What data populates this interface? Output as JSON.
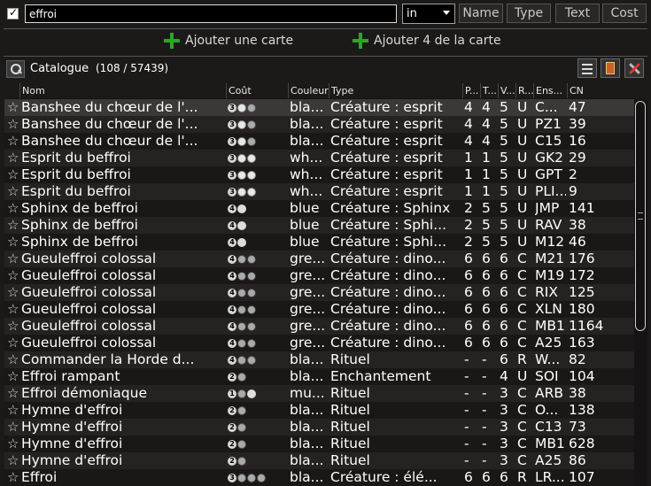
{
  "filter": {
    "checked": true,
    "query": "effroi",
    "mode": "in"
  },
  "sort_buttons": [
    "Name",
    "Type",
    "Text",
    "Cost"
  ],
  "add_buttons": {
    "add_one": "Ajouter une carte",
    "add_four": "Ajouter 4 de la carte"
  },
  "catalogue": {
    "label": "Catalogue",
    "count": "(108 / 57439)"
  },
  "columns": [
    "Nom",
    "Coût",
    "Couleur",
    "Type",
    "P...",
    "T...",
    "V...",
    "R...",
    "Ens...",
    "CN"
  ],
  "rows": [
    {
      "name": "Banshee du chœur de l'...",
      "mana": [
        "3",
        "w",
        "b"
      ],
      "color": "bla...",
      "type": "Créature : esprit",
      "p": "4",
      "t": "4",
      "v": "5",
      "r": "U",
      "set": "C...",
      "cn": "47"
    },
    {
      "name": "Banshee du chœur de l'...",
      "mana": [
        "3",
        "w",
        "b"
      ],
      "color": "bla...",
      "type": "Créature : esprit",
      "p": "4",
      "t": "4",
      "v": "5",
      "r": "U",
      "set": "PZ1",
      "cn": "39"
    },
    {
      "name": "Banshee du chœur de l'...",
      "mana": [
        "3",
        "w",
        "b"
      ],
      "color": "bla...",
      "type": "Créature : esprit",
      "p": "4",
      "t": "4",
      "v": "5",
      "r": "U",
      "set": "C15",
      "cn": "16"
    },
    {
      "name": "Esprit du beffroi",
      "mana": [
        "3",
        "w",
        "w"
      ],
      "color": "wh...",
      "type": "Créature : esprit",
      "p": "1",
      "t": "1",
      "v": "5",
      "r": "U",
      "set": "GK2",
      "cn": "29"
    },
    {
      "name": "Esprit du beffroi",
      "mana": [
        "3",
        "w",
        "w"
      ],
      "color": "wh...",
      "type": "Créature : esprit",
      "p": "1",
      "t": "1",
      "v": "5",
      "r": "U",
      "set": "GPT",
      "cn": "2"
    },
    {
      "name": "Esprit du beffroi",
      "mana": [
        "3",
        "w",
        "w"
      ],
      "color": "wh...",
      "type": "Créature : esprit",
      "p": "1",
      "t": "1",
      "v": "5",
      "r": "U",
      "set": "PLI...",
      "cn": "9"
    },
    {
      "name": "Sphinx de beffroi",
      "mana": [
        "4",
        "u"
      ],
      "color": "blue",
      "type": "Créature : Sphinx",
      "p": "2",
      "t": "5",
      "v": "5",
      "r": "U",
      "set": "JMP",
      "cn": "141"
    },
    {
      "name": "Sphinx de beffroi",
      "mana": [
        "4",
        "u"
      ],
      "color": "blue",
      "type": "Créature : Sphi...",
      "p": "2",
      "t": "5",
      "v": "5",
      "r": "U",
      "set": "RAV",
      "cn": "38"
    },
    {
      "name": "Sphinx de beffroi",
      "mana": [
        "4",
        "u"
      ],
      "color": "blue",
      "type": "Créature : Sphi...",
      "p": "2",
      "t": "5",
      "v": "5",
      "r": "U",
      "set": "M12",
      "cn": "46"
    },
    {
      "name": "Gueuleffroi colossal",
      "mana": [
        "4",
        "g",
        "g"
      ],
      "color": "gre...",
      "type": "Créature : dino...",
      "p": "6",
      "t": "6",
      "v": "6",
      "r": "C",
      "set": "M21",
      "cn": "176"
    },
    {
      "name": "Gueuleffroi colossal",
      "mana": [
        "4",
        "g",
        "g"
      ],
      "color": "gre...",
      "type": "Créature : dino...",
      "p": "6",
      "t": "6",
      "v": "6",
      "r": "C",
      "set": "M19",
      "cn": "172"
    },
    {
      "name": "Gueuleffroi colossal",
      "mana": [
        "4",
        "g",
        "g"
      ],
      "color": "gre...",
      "type": "Créature : dino...",
      "p": "6",
      "t": "6",
      "v": "6",
      "r": "C",
      "set": "RIX",
      "cn": "125"
    },
    {
      "name": "Gueuleffroi colossal",
      "mana": [
        "4",
        "g",
        "g"
      ],
      "color": "gre...",
      "type": "Créature : dino...",
      "p": "6",
      "t": "6",
      "v": "6",
      "r": "C",
      "set": "XLN",
      "cn": "180"
    },
    {
      "name": "Gueuleffroi colossal",
      "mana": [
        "4",
        "g",
        "g"
      ],
      "color": "gre...",
      "type": "Créature : dino...",
      "p": "6",
      "t": "6",
      "v": "6",
      "r": "C",
      "set": "MB1",
      "cn": "1164"
    },
    {
      "name": "Gueuleffroi colossal",
      "mana": [
        "4",
        "g",
        "g"
      ],
      "color": "gre...",
      "type": "Créature : dino...",
      "p": "6",
      "t": "6",
      "v": "6",
      "r": "C",
      "set": "A25",
      "cn": "163"
    },
    {
      "name": "Commander la Horde d...",
      "mana": [
        "4",
        "b",
        "b"
      ],
      "color": "bla...",
      "type": "Rituel",
      "p": "-",
      "t": "-",
      "v": "6",
      "r": "R",
      "set": "W...",
      "cn": "82"
    },
    {
      "name": "Effroi rampant",
      "mana": [
        "2",
        "b"
      ],
      "color": "bla...",
      "type": "Enchantement",
      "p": "-",
      "t": "-",
      "v": "4",
      "r": "U",
      "set": "SOI",
      "cn": "104"
    },
    {
      "name": "Effroi démoniaque",
      "mana": [
        "1",
        "b",
        "r"
      ],
      "color": "mu...",
      "type": "Rituel",
      "p": "-",
      "t": "-",
      "v": "3",
      "r": "C",
      "set": "ARB",
      "cn": "38"
    },
    {
      "name": "Hymne d'effroi",
      "mana": [
        "2",
        "b"
      ],
      "color": "bla...",
      "type": "Rituel",
      "p": "-",
      "t": "-",
      "v": "3",
      "r": "C",
      "set": "O...",
      "cn": "138"
    },
    {
      "name": "Hymne d'effroi",
      "mana": [
        "2",
        "b"
      ],
      "color": "bla...",
      "type": "Rituel",
      "p": "-",
      "t": "-",
      "v": "3",
      "r": "C",
      "set": "C13",
      "cn": "73"
    },
    {
      "name": "Hymne d'effroi",
      "mana": [
        "2",
        "b"
      ],
      "color": "bla...",
      "type": "Rituel",
      "p": "-",
      "t": "-",
      "v": "3",
      "r": "C",
      "set": "MB1",
      "cn": "628"
    },
    {
      "name": "Hymne d'effroi",
      "mana": [
        "2",
        "b"
      ],
      "color": "bla...",
      "type": "Rituel",
      "p": "-",
      "t": "-",
      "v": "3",
      "r": "C",
      "set": "A25",
      "cn": "86"
    },
    {
      "name": "Effroi",
      "mana": [
        "3",
        "b",
        "b",
        "b"
      ],
      "color": "bla...",
      "type": "Créature : élé...",
      "p": "6",
      "t": "6",
      "v": "6",
      "r": "R",
      "set": "LR...",
      "cn": "107"
    }
  ]
}
